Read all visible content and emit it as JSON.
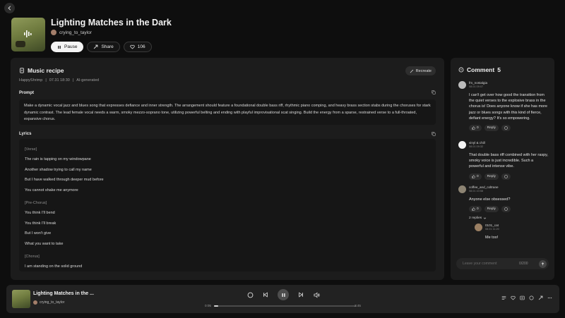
{
  "song": {
    "title": "Lighting Matches in the Dark",
    "artist": "crying_to_taylor"
  },
  "actions": {
    "pause_label": "Pause",
    "share_label": "Share",
    "like_count": "106"
  },
  "recipe": {
    "heading": "Music recipe",
    "author": "HappyShrimp",
    "date": "07.31 18:30",
    "source": "AI-generated",
    "recreate_label": "Recreate",
    "prompt_label": "Prompt",
    "prompt_text": "Make a dynamic vocal jazz and blues song that expresses defiance and inner strength. The arrangement should feature a foundational double bass riff, rhythmic piano comping, and heavy brass section stabs during the choruses for stark dynamic contrast. The lead female vocal needs a warm, smoky mezzo-soprano tone, utilizing powerful belting and ending with playful improvisational scat singing. Build the energy from a sparse, restrained verse to a full-throated, expansive chorus.",
    "lyrics_label": "Lyrics",
    "lyrics": [
      "[Verse]",
      "The rain is tapping on my windowpane",
      "Another shadow trying to call my name",
      "But I have walked through deeper mud before",
      "You cannot shake me anymore",
      "",
      "[Pre-Chorus]",
      "You think I'll bend",
      "You think I'll break",
      "But I won't give",
      "What you want to take",
      "",
      "[Chorus]",
      "I am standing on the solid ground"
    ]
  },
  "comments": {
    "heading": "Comment",
    "count": "5",
    "items": [
      {
        "user": "fm_nostalgia",
        "time": "08.01 09:07",
        "text": "I can't get over how good the transition from the quiet verses to the explosive brass in the chorus is! Does anyone know if she has more jazz or blues songs with this kind of fierce, defiant energy? It's so empowering.",
        "likes": "0",
        "reply_label": "Reply",
        "avatar_color": "#bcbcbc"
      },
      {
        "user": "vinyl & chill",
        "time": "08.01 09:32",
        "text": "That double bass riff combined with her raspy, smoky voice is just incredible. Such a powerful and intense vibe.",
        "likes": "0",
        "reply_label": "Reply",
        "avatar_color": "#f4f4f4"
      },
      {
        "user": "coffee_and_coltrane",
        "time": "08.01 10:58",
        "text": "Anyone else obsessed?",
        "likes": "0",
        "reply_label": "Reply",
        "avatar_color": "#8d8473",
        "replies_toggle": "2 replies",
        "reply": {
          "user": "0101_cat",
          "time": "08.01 11:20",
          "text": "Me too!",
          "avatar_color": "#9a7f63"
        }
      }
    ],
    "input_placeholder": "Leave your comment",
    "char_count": "0/200"
  },
  "player": {
    "title": "Lighting Matches in the ...",
    "artist": "crying_to_taylor",
    "current_time": "0:05",
    "duration": "2:45",
    "progress": 0.03
  },
  "colors": {
    "background": "#0e0e0e",
    "panel": "#1c1c1c",
    "player": "#222222",
    "accent_light": "#f4f4f4"
  },
  "icons": {
    "back": "arrow-left-icon",
    "pause": "pause-icon",
    "share": "share-icon",
    "like": "heart-icon",
    "recipe": "document-icon",
    "recreate": "wand-icon",
    "copy": "copy-icon",
    "comment": "chat-bubble-icon",
    "thumbs_up": "thumbs-up-icon",
    "more": "more-icon",
    "send": "send-arrow-icon"
  }
}
